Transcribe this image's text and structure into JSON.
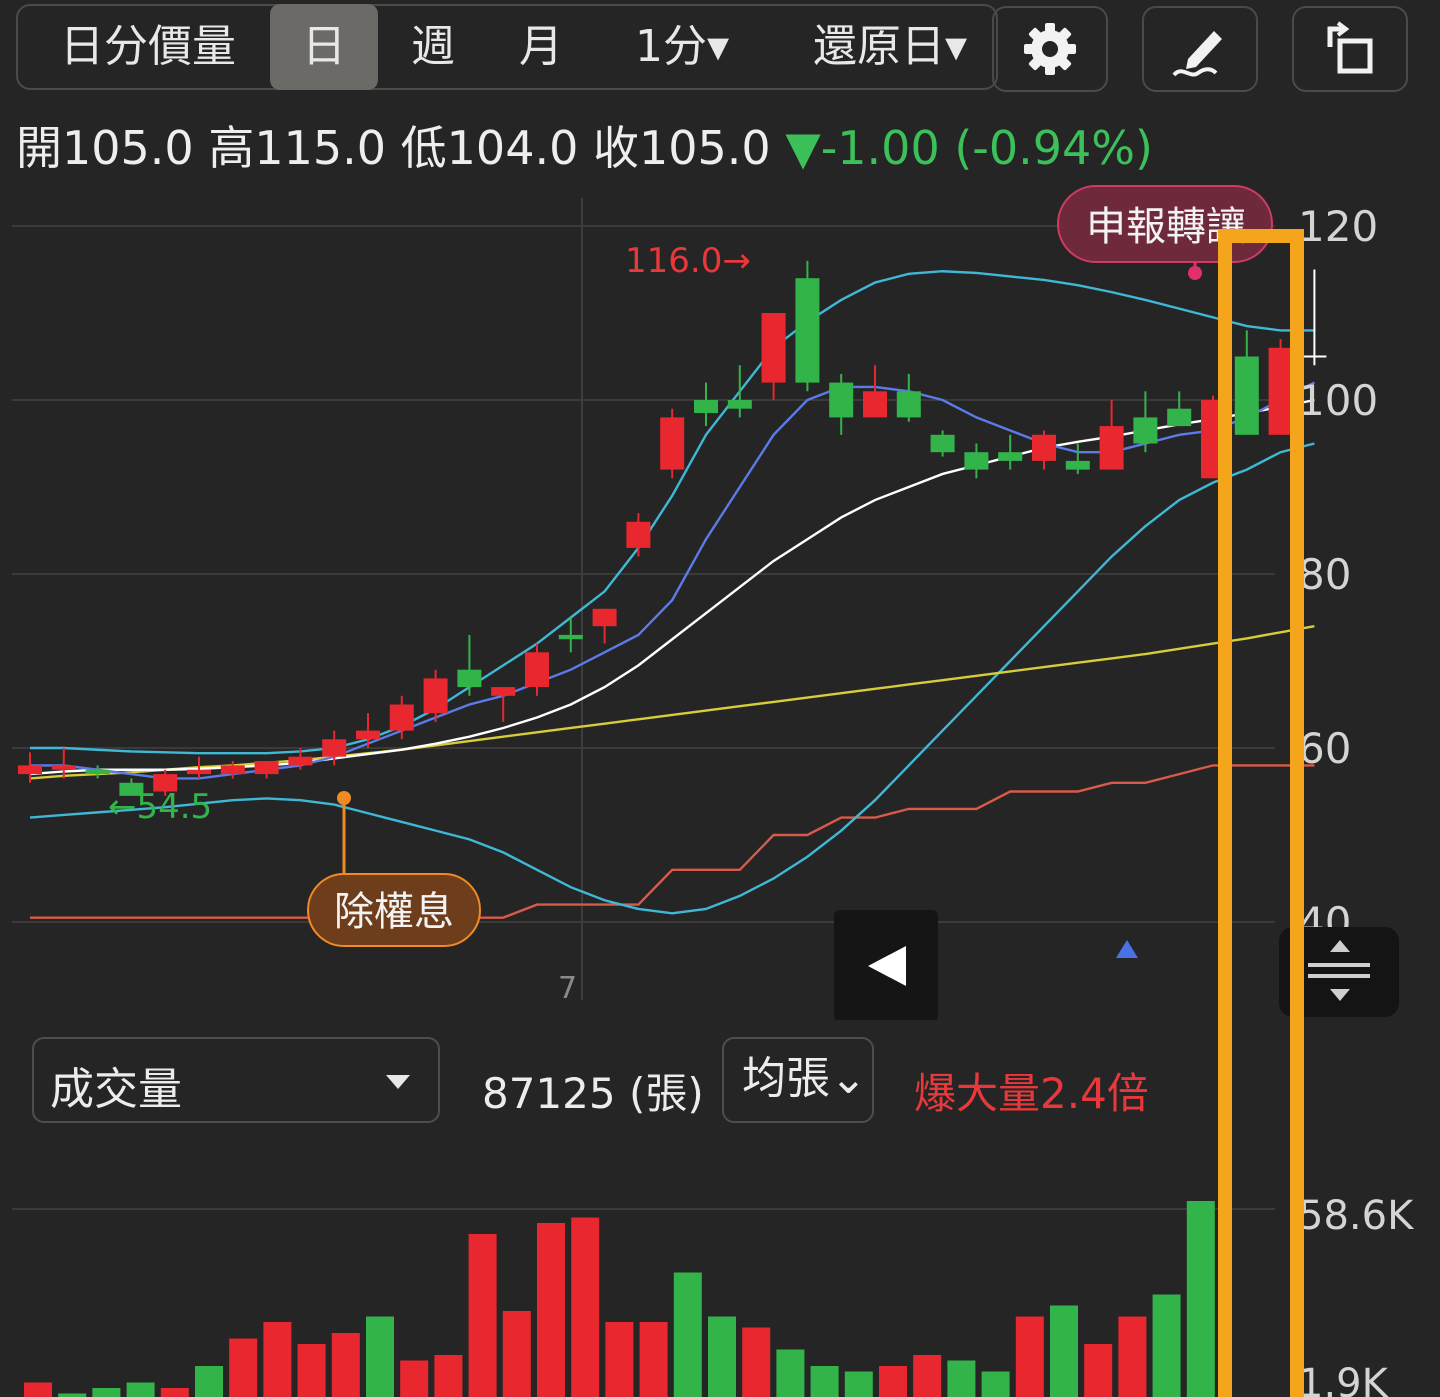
{
  "toolbar": {
    "tabs": [
      {
        "label": "日分價量",
        "active": false
      },
      {
        "label": "日",
        "active": true
      },
      {
        "label": "週",
        "active": false
      },
      {
        "label": "月",
        "active": false
      },
      {
        "label": "1分▾",
        "active": false
      },
      {
        "label": "還原日▾",
        "active": false
      }
    ],
    "icons": [
      "gear-icon",
      "draw-pen-icon",
      "rotate-screen-icon"
    ]
  },
  "ohlc": {
    "open_label": "開",
    "open": "105.0",
    "high_label": "高",
    "high": "115.0",
    "low_label": "低",
    "low": "104.0",
    "close_label": "收",
    "close": "105.0",
    "change": "▼-1.00 (-0.94%)"
  },
  "annotations": {
    "high_marker": "116.0→",
    "low_marker": "←54.5",
    "ex_dividend": "除權息",
    "transfer_report": "申報轉讓",
    "month_tick": "7"
  },
  "volume_panel": {
    "selector_label": "成交量",
    "value": "87125 (張)",
    "avg_button": "均張⌄",
    "burst_text": "爆大量2.4倍"
  },
  "colors": {
    "up": "#e8282e",
    "down": "#33b44a",
    "ma5": "#5b7be8",
    "ma10": "#ffffff",
    "ma_long": "#d8cc3a",
    "bollinger": "#3fb8d6",
    "red_line": "#d85a4a",
    "highlight": "#f4a51c"
  },
  "chart_data": [
    {
      "type": "candlestick",
      "title": "",
      "y_axis_ticks": [
        "120",
        "100",
        "80",
        "60",
        "40"
      ],
      "ylim": [
        36,
        124
      ],
      "candles": [
        {
          "o": 57,
          "c": 58,
          "h": 59.5,
          "l": 56
        },
        {
          "o": 57.5,
          "c": 58,
          "h": 60,
          "l": 56.5
        },
        {
          "o": 57.5,
          "c": 57,
          "h": 58,
          "l": 56.5
        },
        {
          "o": 56,
          "c": 54.5,
          "h": 56.5,
          "l": 54.5
        },
        {
          "o": 55,
          "c": 57,
          "h": 57.5,
          "l": 54.5
        },
        {
          "o": 57,
          "c": 57.5,
          "h": 59,
          "l": 56.5
        },
        {
          "o": 57,
          "c": 58,
          "h": 58.5,
          "l": 56.5
        },
        {
          "o": 57,
          "c": 58.5,
          "h": 58.5,
          "l": 56.5
        },
        {
          "o": 58,
          "c": 59,
          "h": 60,
          "l": 57.5
        },
        {
          "o": 59,
          "c": 61,
          "h": 62,
          "l": 58
        },
        {
          "o": 61,
          "c": 62,
          "h": 64,
          "l": 60
        },
        {
          "o": 62,
          "c": 65,
          "h": 66,
          "l": 61
        },
        {
          "o": 64,
          "c": 68,
          "h": 69,
          "l": 63
        },
        {
          "o": 69,
          "c": 67,
          "h": 73,
          "l": 66
        },
        {
          "o": 66,
          "c": 67,
          "h": 67,
          "l": 63
        },
        {
          "o": 67,
          "c": 71,
          "h": 72,
          "l": 66
        },
        {
          "o": 73,
          "c": 72.5,
          "h": 75,
          "l": 71
        },
        {
          "o": 74,
          "c": 76,
          "h": 76,
          "l": 72
        },
        {
          "o": 83,
          "c": 86,
          "h": 87,
          "l": 82
        },
        {
          "o": 92,
          "c": 98,
          "h": 99,
          "l": 91
        },
        {
          "o": 100,
          "c": 98.5,
          "h": 102,
          "l": 97
        },
        {
          "o": 100,
          "c": 99,
          "h": 104,
          "l": 98
        },
        {
          "o": 102,
          "c": 110,
          "h": 110,
          "l": 100
        },
        {
          "o": 114,
          "c": 102,
          "h": 116,
          "l": 101
        },
        {
          "o": 102,
          "c": 98,
          "h": 103,
          "l": 96
        },
        {
          "o": 98,
          "c": 101,
          "h": 104,
          "l": 98
        },
        {
          "o": 101,
          "c": 98,
          "h": 103,
          "l": 97.5
        },
        {
          "o": 96,
          "c": 94,
          "h": 96.5,
          "l": 93.5
        },
        {
          "o": 94,
          "c": 92,
          "h": 95,
          "l": 91
        },
        {
          "o": 94,
          "c": 93,
          "h": 96,
          "l": 92
        },
        {
          "o": 93,
          "c": 96,
          "h": 96.5,
          "l": 92
        },
        {
          "o": 93,
          "c": 92,
          "h": 95,
          "l": 91.5
        },
        {
          "o": 92,
          "c": 97,
          "h": 100,
          "l": 92
        },
        {
          "o": 98,
          "c": 95,
          "h": 101,
          "l": 94
        },
        {
          "o": 99,
          "c": 97,
          "h": 101,
          "l": 97
        },
        {
          "o": 91,
          "c": 100,
          "h": 100.5,
          "l": 91
        },
        {
          "o": 105,
          "c": 96,
          "h": 108,
          "l": 96
        },
        {
          "o": 96,
          "c": 106,
          "h": 107,
          "l": 96
        }
      ],
      "last_candle": {
        "o": 105,
        "c": 105,
        "h": 115,
        "l": 104
      },
      "ma5": [
        58,
        58,
        57.5,
        57,
        56.5,
        56.5,
        57,
        57.5,
        58,
        59,
        60.5,
        62,
        63.5,
        65,
        66,
        67.5,
        69,
        71,
        73,
        77,
        84,
        90,
        96,
        100,
        101.5,
        101.5,
        101,
        100,
        98,
        96.5,
        95,
        94,
        94,
        95,
        96,
        96.5,
        98,
        100,
        102
      ],
      "ma10": [
        57,
        57.3,
        57.5,
        57.5,
        57.5,
        57.6,
        57.8,
        58,
        58.3,
        58.8,
        59.3,
        59.8,
        60.5,
        61.3,
        62.3,
        63.5,
        65,
        67,
        69.5,
        72.5,
        75.5,
        78.5,
        81.5,
        84,
        86.5,
        88.5,
        90,
        91.5,
        92.5,
        93.5,
        94.5,
        95.2,
        95.8,
        96.5,
        97.2,
        97.8,
        98.5,
        99.2,
        100
      ],
      "ma_long": [
        56.5,
        56.8,
        57,
        57.2,
        57.5,
        57.8,
        58,
        58.3,
        58.6,
        59,
        59.4,
        59.8,
        60.3,
        60.8,
        61.3,
        61.8,
        62.3,
        62.8,
        63.3,
        63.8,
        64.3,
        64.8,
        65.3,
        65.8,
        66.3,
        66.8,
        67.3,
        67.8,
        68.3,
        68.8,
        69.3,
        69.8,
        70.3,
        70.8,
        71.4,
        72,
        72.6,
        73.3,
        74
      ],
      "bollinger_upper": [
        60,
        60,
        59.8,
        59.6,
        59.5,
        59.4,
        59.4,
        59.4,
        59.6,
        60,
        61,
        62.5,
        64.5,
        67,
        69.5,
        72,
        75,
        78,
        83,
        89,
        96,
        101,
        106,
        109,
        111.5,
        113.5,
        114.5,
        114.8,
        114.6,
        114.2,
        113.8,
        113.2,
        112.4,
        111.5,
        110.5,
        109.5,
        108.5,
        108,
        108
      ],
      "bollinger_lower": [
        52,
        52.3,
        52.6,
        52.9,
        53.2,
        53.6,
        54,
        54.2,
        54,
        53.5,
        52.5,
        51.5,
        50.5,
        49.5,
        48,
        46,
        44,
        42.5,
        41.5,
        41,
        41.5,
        43,
        45,
        47.5,
        50.5,
        54,
        58,
        62,
        66,
        70,
        74,
        78,
        82,
        85.5,
        88.5,
        90.5,
        92,
        94,
        95
      ],
      "red_line": [
        40.5,
        40.5,
        40.5,
        40.5,
        40.5,
        40.5,
        40.5,
        40.5,
        40.5,
        40.5,
        40.5,
        40.5,
        40.5,
        40.5,
        40.5,
        42,
        42,
        42,
        42,
        46,
        46,
        46,
        50,
        50,
        52,
        52,
        53,
        53,
        53,
        55,
        55,
        55,
        56,
        56,
        57,
        58,
        58,
        58,
        58
      ]
    },
    {
      "type": "bar",
      "title": "成交量",
      "y_axis_ticks": [
        "58.6K",
        "1.9K"
      ],
      "values": [
        3,
        1,
        2,
        3,
        2,
        6,
        11,
        14,
        10,
        12,
        15,
        7,
        8,
        30,
        16,
        32,
        33,
        14,
        14,
        23,
        15,
        13,
        9,
        6,
        5,
        6,
        8,
        7,
        5,
        15,
        17,
        10,
        15,
        19,
        36
      ],
      "colors": [
        "up",
        "down",
        "down",
        "down",
        "up",
        "down",
        "up",
        "up",
        "up",
        "up",
        "down",
        "up",
        "up",
        "up",
        "up",
        "up",
        "up",
        "up",
        "up",
        "down",
        "down",
        "up",
        "down",
        "down",
        "down",
        "up",
        "up",
        "down",
        "down",
        "up",
        "down",
        "up",
        "up",
        "down",
        "down"
      ]
    }
  ]
}
